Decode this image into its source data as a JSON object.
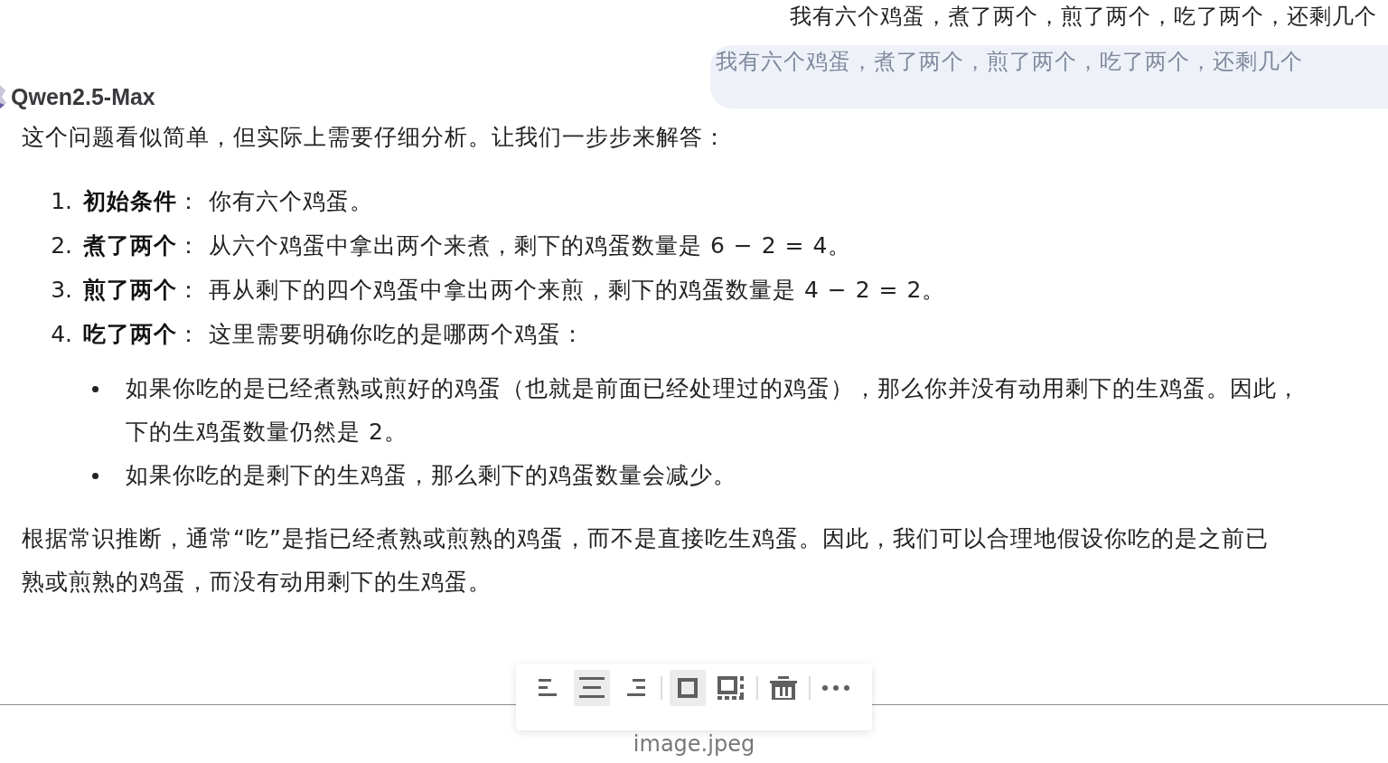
{
  "question_top": "我有六个鸡蛋，煮了两个，煎了两个，吃了两个，还剩几个",
  "question_bubble": "我有六个鸡蛋，煮了两个，煎了两个，吃了两个，还剩几个",
  "model_name": "Qwen2.5-Max",
  "intro": "这个问题看似简单，但实际上需要仔细分析。让我们一步步来解答：",
  "steps": [
    {
      "number": "1.",
      "text": "**初始条件**： 你有六个鸡蛋。"
    },
    {
      "number": "2.",
      "text": "**煮了两个**： 从六个鸡蛋中拿出两个来煮，剩下的鸡蛋数量是 6 − 2 = 4。"
    },
    {
      "number": "3.",
      "text": "**煎了两个**： 再从剩下的四个鸡蛋中拿出两个来煎，剩下的鸡蛋数量是 4 − 2 = 2。"
    },
    {
      "number": "4.",
      "text": "**吃了两个**： 这里需要明确你吃的是哪两个鸡蛋："
    }
  ],
  "bullets": [
    {
      "lines": [
        "如果你吃的是已经煮熟或煎好的鸡蛋（也就是前面已经处理过的鸡蛋），那么你并没有动用剩下的生鸡蛋。因此，",
        "下的生鸡蛋数量仍然是 2。"
      ]
    },
    {
      "lines": [
        "如果你吃的是剩下的生鸡蛋，那么剩下的鸡蛋数量会减少。"
      ]
    }
  ],
  "conclusion": [
    "根据常识推断，通常“吃”是指已经煮熟或煎熟的鸡蛋，而不是直接吃生鸡蛋。因此，我们可以合理地假设你吃的是之前已",
    "熟或煎熟的鸡蛋，而没有动用剩下的生鸡蛋。"
  ],
  "toolbar": {
    "buttons": [
      {
        "kind": "align-left",
        "selected": false
      },
      {
        "kind": "align-center",
        "selected": true
      },
      {
        "kind": "align-right",
        "selected": false
      },
      {
        "kind": "separator"
      },
      {
        "kind": "inline",
        "selected": true
      },
      {
        "kind": "wrap",
        "selected": false
      },
      {
        "kind": "separator"
      },
      {
        "kind": "delete",
        "selected": false
      },
      {
        "kind": "separator"
      },
      {
        "kind": "more",
        "selected": false
      }
    ]
  },
  "caption": "image.jpeg"
}
